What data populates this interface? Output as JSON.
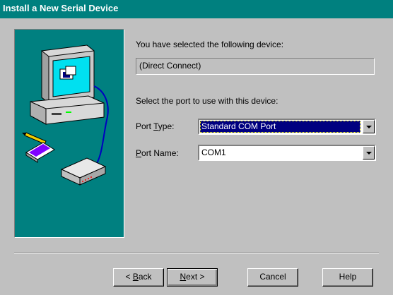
{
  "window": {
    "title": "Install a New Serial Device"
  },
  "main": {
    "selected_prompt": "You have selected the following device:",
    "device_name": "(Direct Connect)",
    "port_prompt": "Select the port to use with this device:",
    "port_type": {
      "label_mnemonic": "T",
      "label_rest": "ype:",
      "label_prefix": "Port ",
      "value": "Standard COM Port"
    },
    "port_name": {
      "label_mnemonic": "P",
      "label_rest": "ort Name:",
      "value": "COM1"
    }
  },
  "buttons": {
    "back": {
      "prefix": "< ",
      "mnemonic": "B",
      "rest": "ack"
    },
    "next": {
      "mnemonic": "N",
      "rest": "ext >"
    },
    "cancel": "Cancel",
    "help": "Help"
  },
  "colors": {
    "title_bar": "#00807f",
    "panel": "#008080",
    "face": "#c0c0c0",
    "highlight": "#000080"
  },
  "icons": [
    "computer-icon",
    "modem-icon",
    "pencil-icon",
    "card-icon"
  ]
}
